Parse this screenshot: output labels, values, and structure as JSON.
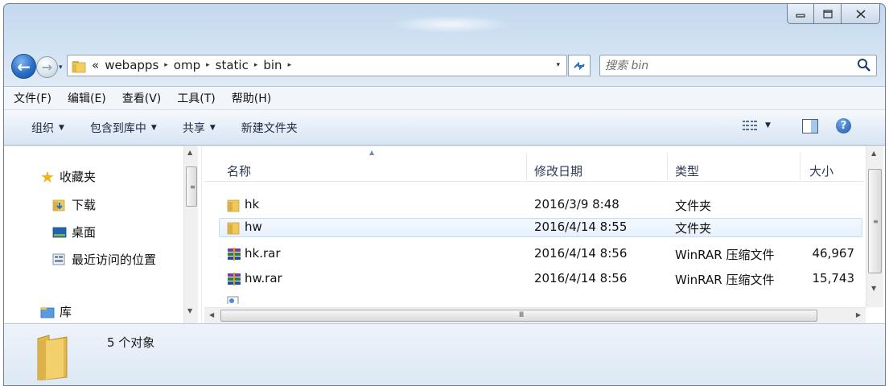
{
  "window": {
    "title": "",
    "caption_buttons": {
      "minimize": "▭",
      "maximize": "□",
      "close": "✕"
    }
  },
  "nav": {
    "breadcrumb_prefix": "«",
    "crumbs": [
      "webapps",
      "omp",
      "static",
      "bin"
    ],
    "separator": "▸",
    "dropdown": "▾",
    "search": {
      "placeholder": "搜索 bin"
    }
  },
  "menu": [
    "文件(F)",
    "编辑(E)",
    "查看(V)",
    "工具(T)",
    "帮助(H)"
  ],
  "toolbar": {
    "organize": "组织",
    "include_in_library": "包含到库中",
    "share": "共享",
    "new_folder": "新建文件夹",
    "dropdown_arrow": "▼",
    "help": "?"
  },
  "navpane": {
    "favorites": "收藏夹",
    "downloads": "下载",
    "desktop": "桌面",
    "recent_places": "最近访问的位置",
    "libraries": "库"
  },
  "columns": {
    "name": "名称",
    "modified": "修改日期",
    "type": "类型",
    "size": "大小"
  },
  "files": [
    {
      "name": "hk",
      "modified": "2016/3/9 8:48",
      "type": "文件夹",
      "size": "",
      "icon": "folder-icon",
      "selected": false
    },
    {
      "name": "hw",
      "modified": "2016/4/14 8:55",
      "type": "文件夹",
      "size": "",
      "icon": "folder-icon",
      "selected": true
    },
    {
      "name": "hk.rar",
      "modified": "2016/4/14 8:56",
      "type": "WinRAR 压缩文件",
      "size": "46,967",
      "icon": "winrar-icon",
      "selected": false
    },
    {
      "name": "hw.rar",
      "modified": "2016/4/14 8:56",
      "type": "WinRAR 压缩文件",
      "size": "15,743",
      "icon": "winrar-icon",
      "selected": false
    }
  ],
  "status": {
    "object_count": "5 个对象"
  },
  "colors": {
    "accent": "#2a6fc6",
    "selection": "#e6f0fb",
    "chrome": "#d3e3f3"
  }
}
